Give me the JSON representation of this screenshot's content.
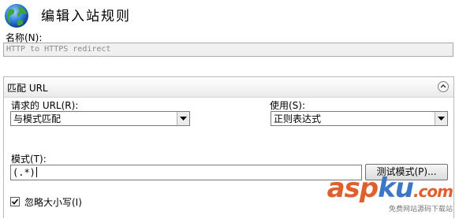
{
  "header": {
    "title": "编辑入站规则",
    "icon": "globe-icon"
  },
  "name": {
    "label": "名称(N):",
    "value": "HTTP to HTTPS redirect"
  },
  "match_url": {
    "section_title": "匹配 URL",
    "requested_url_label": "请求的 URL(R):",
    "requested_url_value": "与模式匹配",
    "using_label": "使用(S):",
    "using_value": "正则表达式",
    "pattern_label": "模式(T):",
    "pattern_value": "(.*)",
    "test_button": "测试模式(P)...",
    "ignore_case_label": "忽略大小写(I)",
    "ignore_case_checked": true
  },
  "watermark": {
    "logo_a": "asp",
    "logo_b": "ku",
    "logo_c": ".com",
    "tagline": "免费网站源码下载站"
  },
  "colors": {
    "watermark_orange": "#e0602d",
    "watermark_blue": "#3c76c4"
  }
}
